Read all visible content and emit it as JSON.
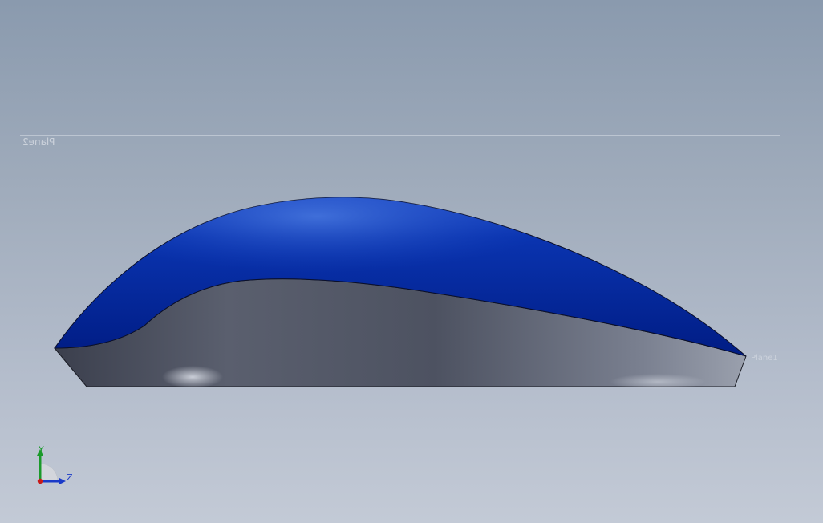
{
  "viewport": {
    "background_top": "#8a9aae",
    "background_bottom": "#c3cad6"
  },
  "model": {
    "top_surface_color": "#0a2a9c",
    "side_surface_color": "#5e6473",
    "plane_labels": [
      "Plane2",
      "Plane1"
    ]
  },
  "triad": {
    "y_label": "Y",
    "z_label": "Z",
    "y_color": "#1a9a2a",
    "z_color": "#1a3ac8",
    "x_color": "#c81a1a"
  }
}
